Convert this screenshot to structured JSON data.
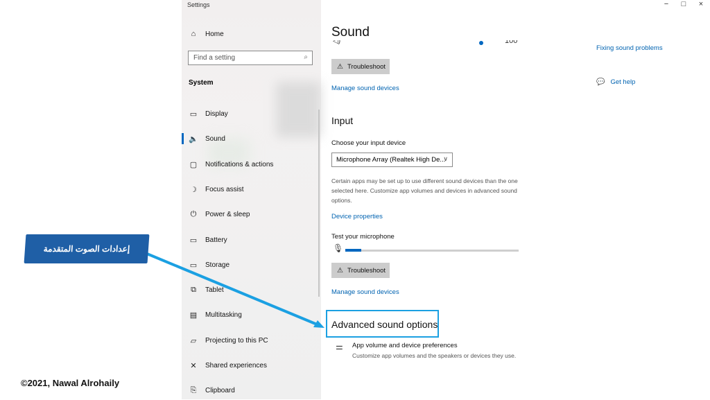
{
  "window": {
    "title": "Settings",
    "minimize_glyph": "−",
    "maximize_glyph": "□",
    "close_glyph": "×"
  },
  "sidebar": {
    "home_label": "Home",
    "search_placeholder": "Find a setting",
    "section_title": "System",
    "items": [
      {
        "label": "Display",
        "icon": "monitor-icon"
      },
      {
        "label": "Sound",
        "icon": "speaker-icon",
        "selected": true
      },
      {
        "label": "Notifications & actions",
        "icon": "notification-icon"
      },
      {
        "label": "Focus assist",
        "icon": "moon-icon"
      },
      {
        "label": "Power & sleep",
        "icon": "power-icon"
      },
      {
        "label": "Battery",
        "icon": "battery-icon"
      },
      {
        "label": "Storage",
        "icon": "storage-icon"
      },
      {
        "label": "Tablet",
        "icon": "tablet-icon"
      },
      {
        "label": "Multitasking",
        "icon": "multitasking-icon"
      },
      {
        "label": "Projecting to this PC",
        "icon": "projecting-icon"
      },
      {
        "label": "Shared experiences",
        "icon": "shared-experiences-icon"
      },
      {
        "label": "Clipboard",
        "icon": "clipboard-icon"
      }
    ]
  },
  "main": {
    "title": "Sound",
    "cutoff_value": "100",
    "output": {
      "troubleshoot_label": "Troubleshoot",
      "manage_devices_link": "Manage sound devices"
    },
    "input": {
      "heading": "Input",
      "choose_label": "Choose your input device",
      "device_value": "Microphone Array (Realtek High De...",
      "description": "Certain apps may be set up to use different sound devices than the one selected here. Customize app volumes and devices in advanced sound options.",
      "device_properties_link": "Device properties",
      "test_label": "Test your microphone",
      "mic_level": 0.09,
      "troubleshoot_label": "Troubleshoot",
      "manage_devices_link": "Manage sound devices"
    },
    "advanced": {
      "heading": "Advanced sound options",
      "item_title": "App volume and device preferences",
      "item_desc": "Customize app volumes and the speakers or devices they use."
    }
  },
  "related": {
    "fixing_link": "Fixing sound problems",
    "get_help_link": "Get help"
  },
  "annotation": {
    "callout_text": "إعدادات الصوت المتقدمة",
    "copyright": "©2021, Nawal Alrohaily",
    "highlight_color": "#1ba0e2",
    "callout_color": "#1f5fa6"
  }
}
